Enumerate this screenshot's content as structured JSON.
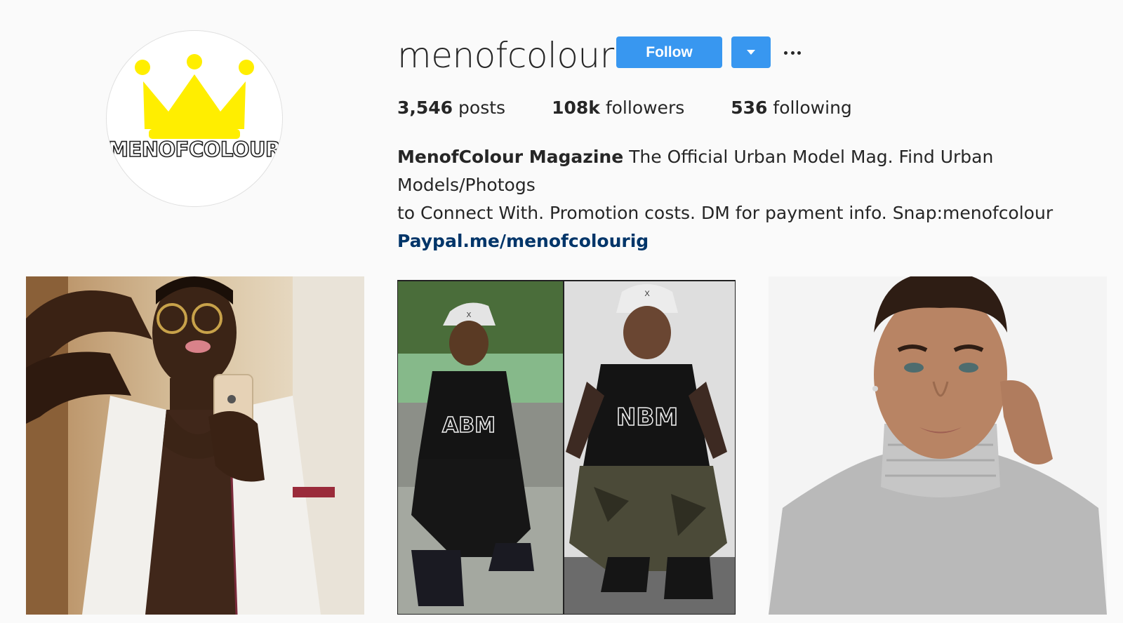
{
  "profile": {
    "username": "menofcolour",
    "avatar_text": "MENOFCOLOUR",
    "avatar_icon": "crown-icon",
    "follow_label": "Follow",
    "stats": {
      "posts_count": "3,546",
      "posts_label": "posts",
      "followers_count": "108k",
      "followers_label": "followers",
      "following_count": "536",
      "following_label": "following"
    },
    "bio": {
      "name": "MenofColour Magazine",
      "line1": "The Official Urban Model Mag. Find Urban Models/Photogs",
      "line2": "to Connect With. Promotion costs. DM for payment info. Snap:menofcolour",
      "link": "Paypal.me/menofcolourig"
    }
  },
  "posts": [
    {
      "shirt_text": ""
    },
    {
      "left_shirt_text": "ABM",
      "right_shirt_text": "NBM",
      "cap_mark": "X"
    },
    {
      "shirt_text": ""
    }
  ],
  "colors": {
    "accent": "#3897f0",
    "link": "#003569",
    "crown": "#ffee00",
    "background": "#fafafa"
  }
}
